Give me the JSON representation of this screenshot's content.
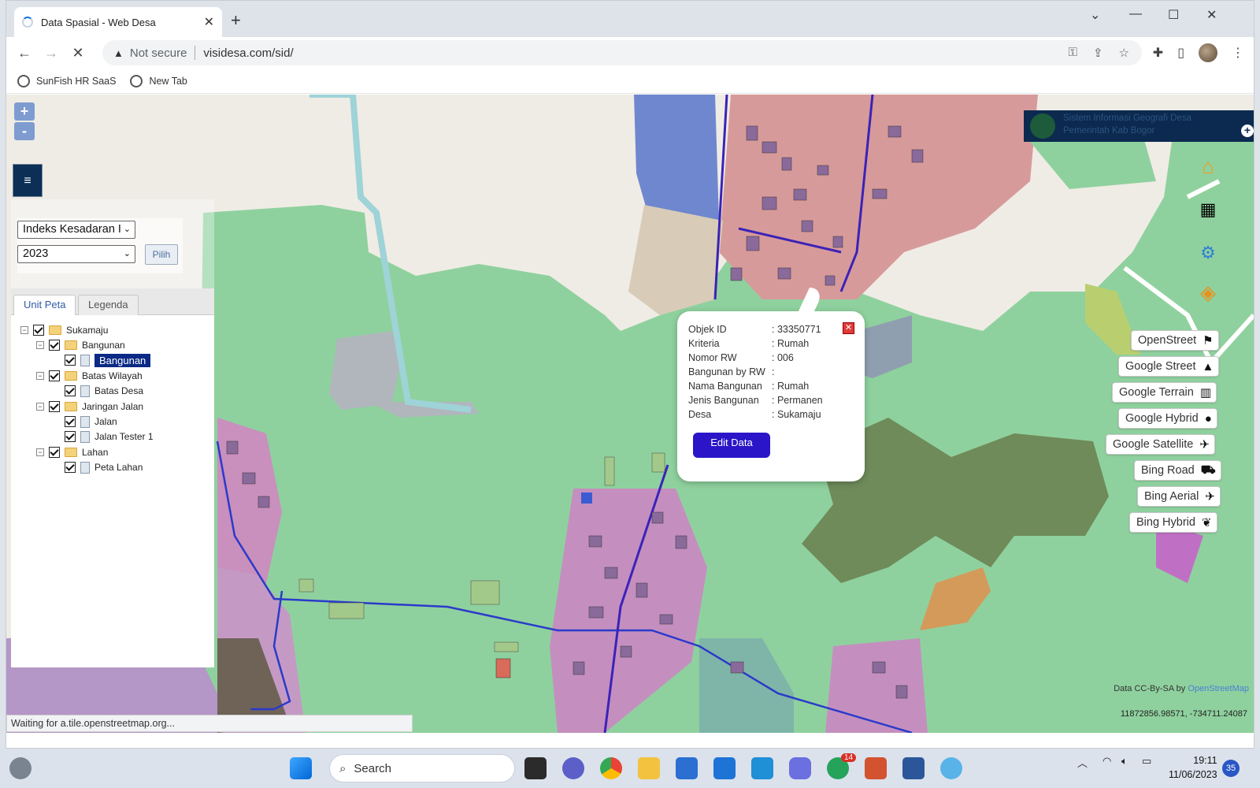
{
  "browser": {
    "tab_title": "Data Spasial - Web Desa",
    "close_tab": "✕",
    "new_tab": "+",
    "address": {
      "security": "Not secure",
      "url": "visidesa.com/sid/"
    },
    "bookmarks": [
      {
        "label": "SunFish HR SaaS"
      },
      {
        "label": "New Tab"
      }
    ],
    "status_text": "Waiting for a.tile.openstreetmap.org..."
  },
  "map": {
    "zoom_in": "+",
    "zoom_out": "-",
    "menu_icon": "≡",
    "filter": {
      "indicator": "Indeks Kesadaran I",
      "year": "2023",
      "button": "Pilih"
    },
    "tabs": {
      "unit_peta": "Unit Peta",
      "legenda": "Legenda"
    },
    "tree": {
      "root": "Sukamaju",
      "bangunan_group": "Bangunan",
      "bangunan_layer": "Bangunan",
      "batas_group": "Batas Wilayah",
      "batas_layer": "Batas Desa",
      "jalan_group": "Jaringan Jalan",
      "jalan_layer": "Jalan",
      "jalan_tester": "Jalan Tester 1",
      "lahan_group": "Lahan",
      "lahan_layer": "Peta Lahan"
    },
    "popup": {
      "rows": [
        {
          "key": "Objek ID",
          "value": ": 33350771"
        },
        {
          "key": "Kriteria",
          "value": ": Rumah"
        },
        {
          "key": "Nomor RW",
          "value": ": 006"
        },
        {
          "key": "Bangunan by RW",
          "value": ":"
        },
        {
          "key": "Nama Bangunan",
          "value": ": Rumah"
        },
        {
          "key": "Jenis Bangunan",
          "value": ": Permanen"
        },
        {
          "key": "Desa",
          "value": ": Sukamaju"
        }
      ],
      "close": "✕",
      "edit_button": "Edit Data"
    },
    "logo_text_1": "Sistem Informasi Geografi Desa",
    "logo_text_2": "Pemerintah Kab Bogor",
    "basemaps": [
      {
        "label": "OpenStreet",
        "icon": "signpost-icon",
        "glyph": "⚑"
      },
      {
        "label": "Google Street",
        "icon": "road-icon",
        "glyph": "▲"
      },
      {
        "label": "Google Terrain",
        "icon": "map-icon",
        "glyph": "▥"
      },
      {
        "label": "Google Hybrid",
        "icon": "globe-icon",
        "glyph": "●"
      },
      {
        "label": "Google Satellite",
        "icon": "satellite-icon",
        "glyph": "✈"
      },
      {
        "label": "Bing Road",
        "icon": "car-icon",
        "glyph": "⛟"
      },
      {
        "label": "Bing Aerial",
        "icon": "plane-icon",
        "glyph": "✈"
      },
      {
        "label": "Bing Hybrid",
        "icon": "leaf-icon",
        "glyph": "❦"
      }
    ],
    "attribution": "Data CC-By-SA by",
    "attribution_link": "OpenStreetMap",
    "coordinates": "11872856.98571, -734711.24087"
  },
  "taskbar": {
    "search_label": "Search",
    "whatsapp_badge": "14",
    "time": "19:11",
    "date": "11/06/2023",
    "notification_count": "35"
  }
}
